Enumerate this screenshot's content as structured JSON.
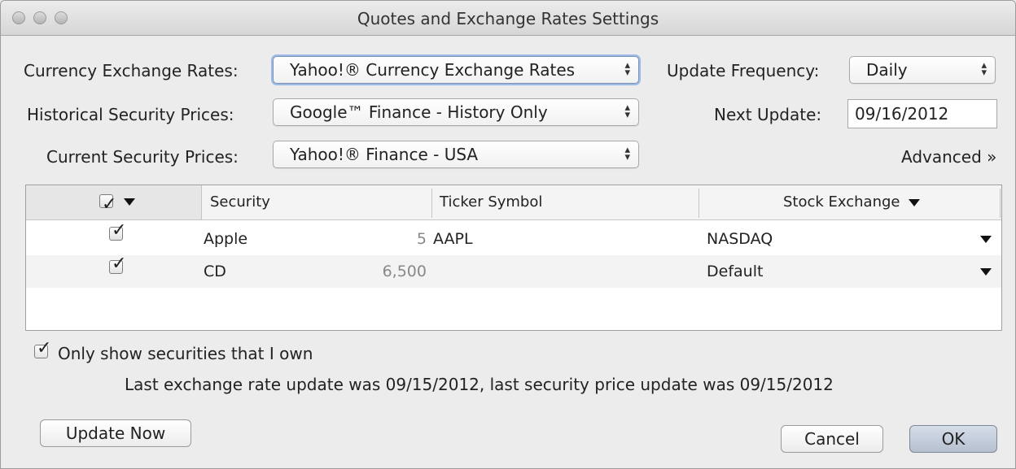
{
  "window": {
    "title": "Quotes and Exchange Rates Settings"
  },
  "settings": {
    "currency_label": "Currency Exchange Rates:",
    "currency_value": "Yahoo!® Currency Exchange Rates",
    "historical_label": "Historical Security Prices:",
    "historical_value": "Google™ Finance - History Only",
    "current_label": "Current Security Prices:",
    "current_value": "Yahoo!® Finance - USA",
    "frequency_label": "Update Frequency:",
    "frequency_value": "Daily",
    "next_update_label": "Next Update:",
    "next_update_value": "09/16/2012",
    "advanced_label": "Advanced »"
  },
  "table": {
    "headers": {
      "security": "Security",
      "ticker": "Ticker Symbol",
      "exchange": "Stock Exchange"
    },
    "rows": [
      {
        "checked": true,
        "security": "Apple",
        "shares": "5",
        "ticker": "AAPL",
        "exchange": "NASDAQ"
      },
      {
        "checked": true,
        "security": "CD",
        "shares": "6,500",
        "ticker": "",
        "exchange": "Default"
      }
    ]
  },
  "footer": {
    "only_owned_label": "Only show securities that I own",
    "status_text": "Last exchange rate update was 09/15/2012, last security price update was 09/15/2012",
    "update_now_label": "Update Now",
    "cancel_label": "Cancel",
    "ok_label": "OK"
  },
  "colors": {
    "window_bg": "#ececec",
    "focus_ring": "#9db9e6",
    "default_button": "#c6cfdc",
    "row_alt": "#f3f3f3"
  }
}
